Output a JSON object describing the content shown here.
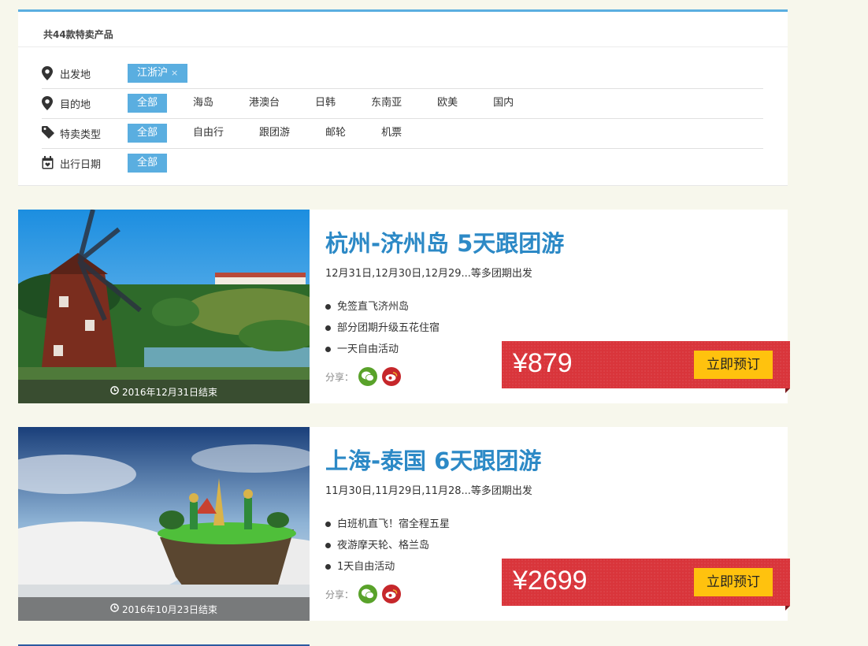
{
  "filter": {
    "count_title": "共44款特卖产品",
    "rows": [
      {
        "label": "出发地",
        "icon": "map-pin-icon",
        "active": "江浙沪",
        "active_close": "×",
        "options": []
      },
      {
        "label": "目的地",
        "icon": "map-pin-icon",
        "active": "全部",
        "options": [
          "海岛",
          "港澳台",
          "日韩",
          "东南亚",
          "欧美",
          "国内"
        ]
      },
      {
        "label": "特卖类型",
        "icon": "tag-icon",
        "active": "全部",
        "options": [
          "自由行",
          "跟团游",
          "邮轮",
          "机票"
        ]
      },
      {
        "label": "出行日期",
        "icon": "calendar-icon",
        "active": "全部",
        "options": []
      }
    ]
  },
  "products": [
    {
      "title": "杭州-济州岛 5天跟团游",
      "dates": "12月31日,12月30日,12月29...等多团期出发",
      "features": [
        "免签直飞济州岛",
        "部分团期升级五花住宿",
        "一天自由活动"
      ],
      "end_text": "2016年12月31日结束",
      "share_label": "分享：",
      "price": "¥879",
      "book_label": "立即预订"
    },
    {
      "title": "上海-泰国 6天跟团游",
      "dates": "11月30日,11月29日,11月28...等多团期出发",
      "features": [
        "白班机直飞！宿全程五星",
        "夜游摩天轮、格兰岛",
        "1天自由活动"
      ],
      "end_text": "2016年10月23日结束",
      "share_label": "分享：",
      "price": "¥2699",
      "book_label": "立即预订"
    }
  ],
  "colors": {
    "accent_blue": "#5aaee0",
    "title_blue": "#2c89c6",
    "price_red": "#d9353b",
    "book_yellow": "#ffc20e",
    "page_bg": "#f7f7ec"
  }
}
